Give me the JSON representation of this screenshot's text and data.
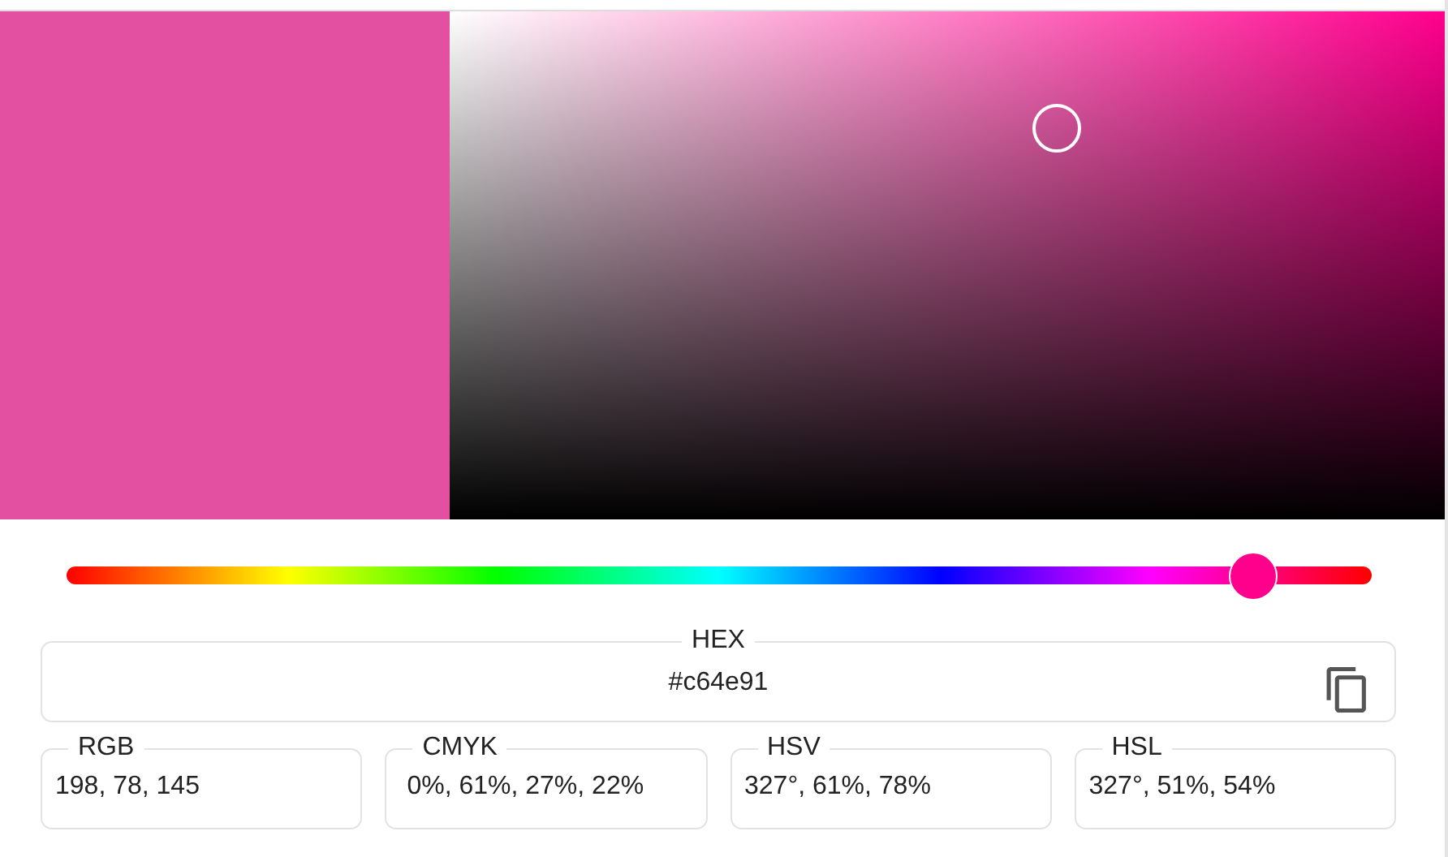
{
  "hue_slider": {
    "level": 0.908
  },
  "hex": {
    "label": "HEX",
    "value": "#c64e91"
  },
  "formats": [
    {
      "label": "RGB",
      "value": "198, 78, 145"
    },
    {
      "label": "CMYK",
      "value": " 0%, 61%, 27%, 22%"
    },
    {
      "label": "HSV",
      "value": "327°, 61%, 78%"
    },
    {
      "label": "HSL",
      "value": "327°, 51%, 54%"
    }
  ]
}
